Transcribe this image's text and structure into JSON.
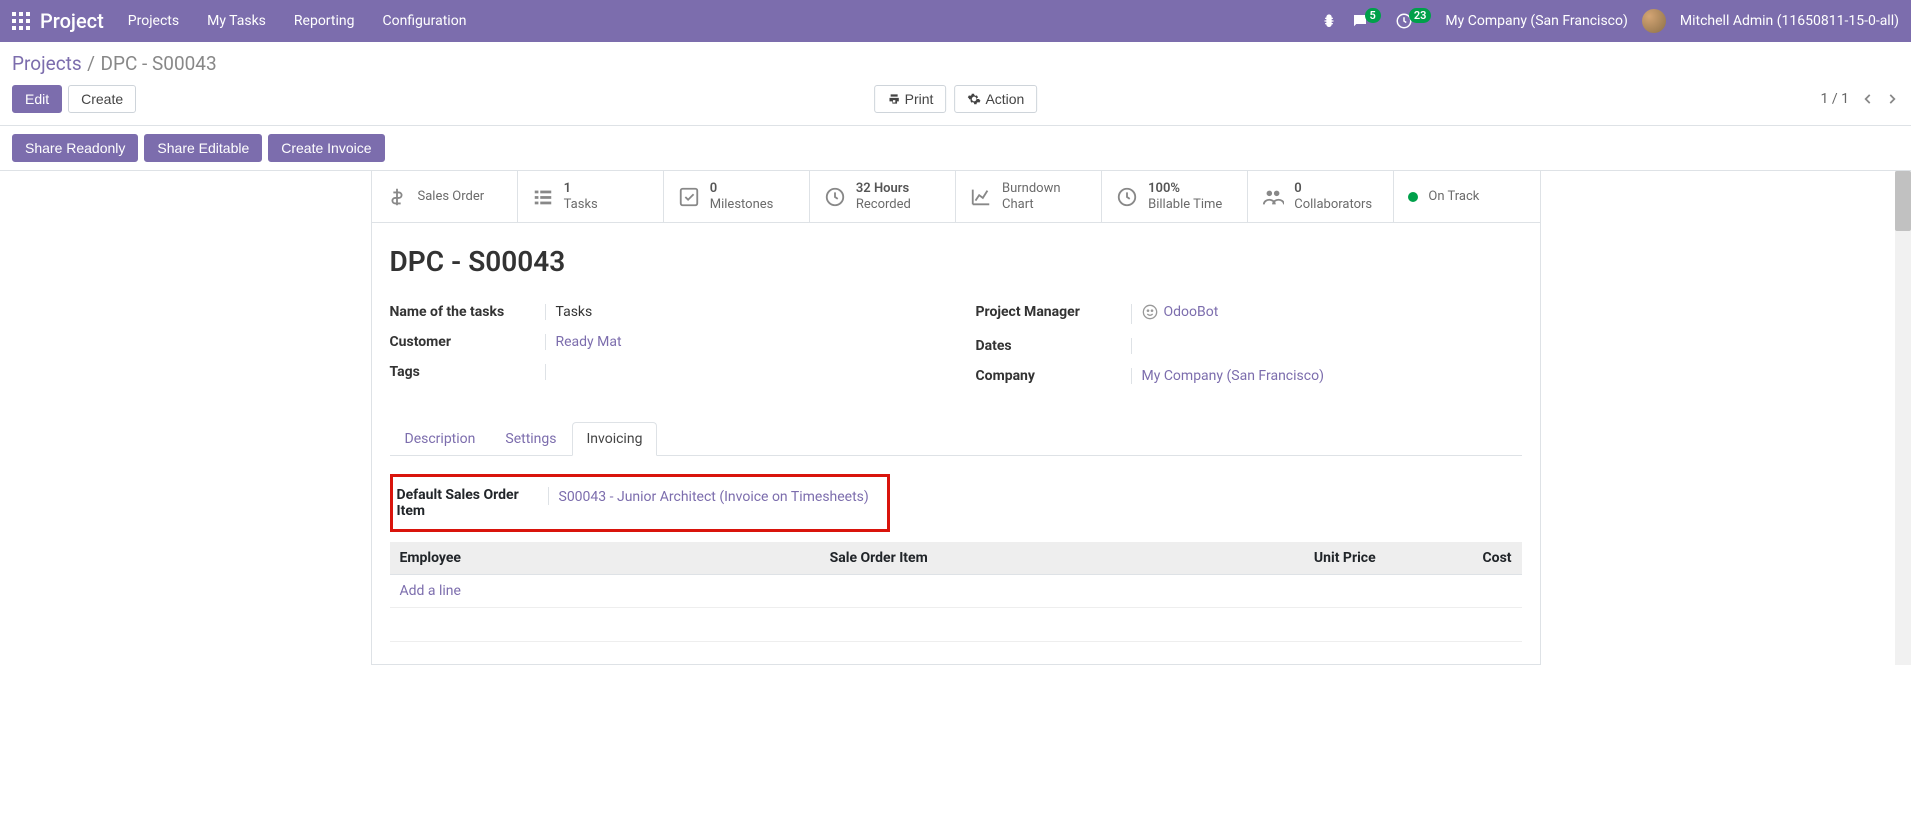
{
  "nav": {
    "brand": "Project",
    "links": [
      "Projects",
      "My Tasks",
      "Reporting",
      "Configuration"
    ],
    "chat_badge": "5",
    "activity_badge": "23",
    "company": "My Company (San Francisco)",
    "user": "Mitchell Admin (11650811-15-0-all)"
  },
  "breadcrumb": {
    "parent": "Projects",
    "current": "DPC - S00043"
  },
  "controls": {
    "edit": "Edit",
    "create": "Create",
    "print": "Print",
    "action": "Action",
    "pager": "1 / 1"
  },
  "share": {
    "readonly": "Share Readonly",
    "editable": "Share Editable",
    "invoice": "Create Invoice"
  },
  "stats": {
    "sales_order": "Sales Order",
    "tasks_value": "1",
    "tasks_label": "Tasks",
    "milestones_value": "0",
    "milestones_label": "Milestones",
    "hours_value": "32 Hours",
    "hours_label": "Recorded",
    "burndown": "Burndown Chart",
    "billable_value": "100%",
    "billable_label": "Billable Time",
    "collab_value": "0",
    "collab_label": "Collaborators",
    "ontrack": "On Track"
  },
  "form": {
    "title": "DPC - S00043",
    "name_tasks_label": "Name of the tasks",
    "name_tasks_value": "Tasks",
    "customer_label": "Customer",
    "customer_value": "Ready Mat",
    "tags_label": "Tags",
    "tags_value": "",
    "pm_label": "Project Manager",
    "pm_value": "OdooBot",
    "dates_label": "Dates",
    "dates_value": "",
    "company_label": "Company",
    "company_value": "My Company (San Francisco)"
  },
  "tabs": {
    "description": "Description",
    "settings": "Settings",
    "invoicing": "Invoicing"
  },
  "invoicing": {
    "default_soi_label": "Default Sales Order Item",
    "default_soi_value": "S00043 - Junior Architect (Invoice on Timesheets)",
    "table": {
      "employee": "Employee",
      "soi": "Sale Order Item",
      "unit_price": "Unit Price",
      "cost": "Cost",
      "add_line": "Add a line"
    }
  }
}
